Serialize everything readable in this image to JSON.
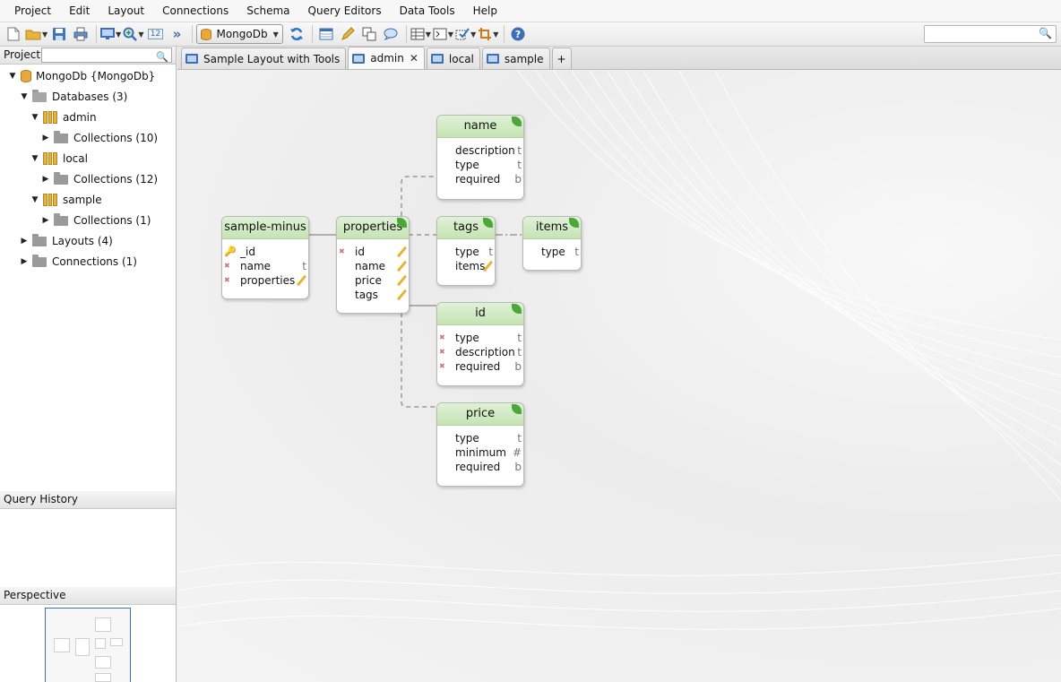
{
  "menu": [
    "Project",
    "Edit",
    "Layout",
    "Connections",
    "Schema",
    "Query Editors",
    "Data Tools",
    "Help"
  ],
  "toolbar": {
    "zoom_value": "12",
    "db_combo": "MongoDb",
    "search_placeholder": ""
  },
  "project_panel": {
    "title": "Project",
    "tree": [
      {
        "label": "MongoDb {MongoDb}",
        "level": 0,
        "icon": "server-icon",
        "expanded": true
      },
      {
        "label": "Databases (3)",
        "level": 1,
        "icon": "folder-open-icon",
        "expanded": true
      },
      {
        "label": "admin",
        "level": 2,
        "icon": "database-icon",
        "expanded": true
      },
      {
        "label": "Collections (10)",
        "level": 3,
        "icon": "folder-icon",
        "expanded": false
      },
      {
        "label": "local",
        "level": 2,
        "icon": "database-icon",
        "expanded": true
      },
      {
        "label": "Collections (12)",
        "level": 3,
        "icon": "folder-icon",
        "expanded": false
      },
      {
        "label": "sample",
        "level": 2,
        "icon": "database-icon",
        "expanded": true
      },
      {
        "label": "Collections (1)",
        "level": 3,
        "icon": "folder-icon",
        "expanded": false
      },
      {
        "label": "Layouts (4)",
        "level": 1,
        "icon": "folder-icon",
        "expanded": false
      },
      {
        "label": "Connections (1)",
        "level": 1,
        "icon": "folder-icon",
        "expanded": false
      }
    ]
  },
  "query_history": {
    "title": "Query History"
  },
  "perspective": {
    "title": "Perspective"
  },
  "tabs": [
    {
      "label": "Sample Layout with Tools",
      "active": false,
      "closable": false
    },
    {
      "label": "admin",
      "active": true,
      "closable": true
    },
    {
      "label": "local",
      "active": false,
      "closable": false
    },
    {
      "label": "sample",
      "active": false,
      "closable": false
    }
  ],
  "tab_add": "+",
  "entities": {
    "sample_minus": {
      "title": "sample-minus",
      "fields": [
        {
          "name": "_id",
          "type": "",
          "mark": "key"
        },
        {
          "name": "name",
          "type": "t",
          "mark": "x"
        },
        {
          "name": "properties",
          "type": "pen",
          "mark": "x"
        }
      ]
    },
    "properties": {
      "title": "properties",
      "fields": [
        {
          "name": "id",
          "type": "pen",
          "mark": "x"
        },
        {
          "name": "name",
          "type": "pen",
          "mark": ""
        },
        {
          "name": "price",
          "type": "pen",
          "mark": ""
        },
        {
          "name": "tags",
          "type": "pen",
          "mark": ""
        }
      ]
    },
    "name": {
      "title": "name",
      "fields": [
        {
          "name": "description",
          "type": "t",
          "mark": ""
        },
        {
          "name": "type",
          "type": "t",
          "mark": ""
        },
        {
          "name": "required",
          "type": "b",
          "mark": ""
        }
      ]
    },
    "tags": {
      "title": "tags",
      "fields": [
        {
          "name": "type",
          "type": "t",
          "mark": ""
        },
        {
          "name": "items",
          "type": "pen",
          "mark": ""
        }
      ]
    },
    "items": {
      "title": "items",
      "fields": [
        {
          "name": "type",
          "type": "t",
          "mark": ""
        }
      ]
    },
    "id": {
      "title": "id",
      "fields": [
        {
          "name": "type",
          "type": "t",
          "mark": "x"
        },
        {
          "name": "description",
          "type": "t",
          "mark": "x"
        },
        {
          "name": "required",
          "type": "b",
          "mark": "x"
        }
      ]
    },
    "price": {
      "title": "price",
      "fields": [
        {
          "name": "type",
          "type": "t",
          "mark": ""
        },
        {
          "name": "minimum",
          "type": "#",
          "mark": ""
        },
        {
          "name": "required",
          "type": "b",
          "mark": ""
        }
      ]
    }
  },
  "colors": {
    "entity_header": "#c9e6b8",
    "accent": "#3d6fb4",
    "leaf": "#4ea53a"
  }
}
